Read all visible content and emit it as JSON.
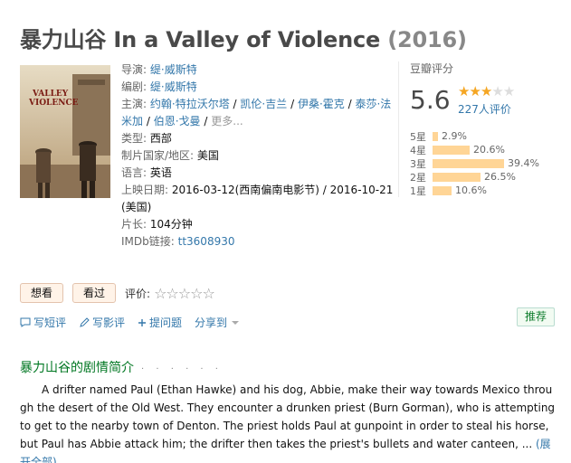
{
  "title": {
    "main": "暴力山谷 In a Valley of Violence",
    "year": "(2016)"
  },
  "info": {
    "director_label": "导演:",
    "director": "缇·威斯特",
    "writer_label": "编剧:",
    "writer": "缇·威斯特",
    "cast_label": "主演:",
    "cast": [
      "约翰·特拉沃尔塔",
      "凯伦·吉兰",
      "伊桑·霍克",
      "泰莎·法米加",
      "伯恩·戈曼"
    ],
    "cast_more": "更多...",
    "sep": "/",
    "genre_label": "类型:",
    "genre": "西部",
    "country_label": "制片国家/地区:",
    "country": "美国",
    "language_label": "语言:",
    "language": "英语",
    "release_label": "上映日期:",
    "release": "2016-03-12(西南偏南电影节) / 2016-10-21(美国)",
    "runtime_label": "片长:",
    "runtime": "104分钟",
    "imdb_label": "IMDb链接:",
    "imdb": "tt3608930"
  },
  "rating": {
    "label": "豆瓣评分",
    "score": "5.6",
    "stars_filled": 3,
    "votes": "227人评价",
    "rows": [
      {
        "star": "5星",
        "pct": "2.9%",
        "value": 2.9
      },
      {
        "star": "4星",
        "pct": "20.6%",
        "value": 20.6
      },
      {
        "star": "3星",
        "pct": "39.4%",
        "value": 39.4
      },
      {
        "star": "2星",
        "pct": "26.5%",
        "value": 26.5
      },
      {
        "star": "1星",
        "pct": "10.6%",
        "value": 10.6
      }
    ]
  },
  "buttons": {
    "want": "想看",
    "seen": "看过",
    "rate_label": "评价:"
  },
  "actions": {
    "short_review": "写短评",
    "review": "写影评",
    "question": "提问题",
    "share": "分享到"
  },
  "recommend": "推荐",
  "summary": {
    "title": "暴力山谷的剧情简介",
    "dots": "· · · · · ·",
    "text": "A drifter named Paul (Ethan Hawke) and his dog, Abbie, make their way towards Mexico through the desert of the Old West. They encounter a drunken priest (Burn Gorman), who is attempting to get to the nearby town of Denton. The priest holds Paul at gunpoint in order to steal his horse, but Paul has Abbie attack him; the drifter then takes the priest's bullets and water canteen, ...",
    "expand": "(展开全部)"
  },
  "colors": {
    "link": "#3377aa",
    "star": "#f5a623",
    "bar": "#ffd596",
    "section": "#007722"
  }
}
